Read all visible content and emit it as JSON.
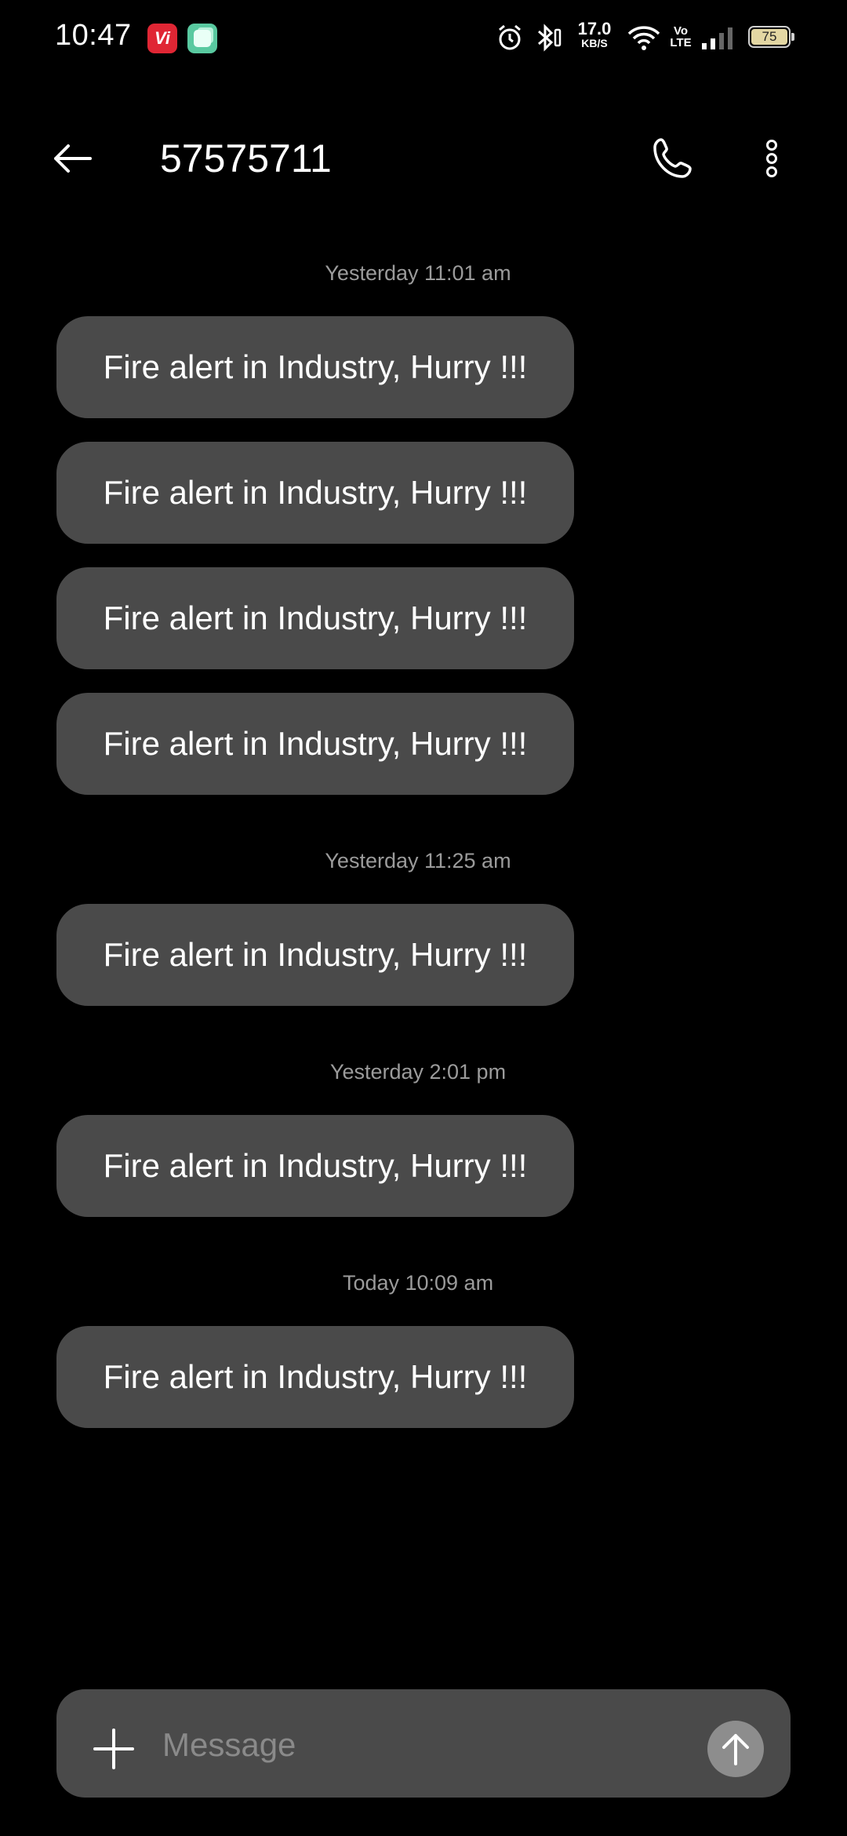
{
  "status_bar": {
    "time": "10:47",
    "app_badge_vi": "Vi",
    "net_speed_value": "17.0",
    "net_speed_unit": "KB/S",
    "volte_top": "Vo",
    "volte_bottom": "LTE",
    "battery": "75",
    "icons": [
      "alarm-icon",
      "bluetooth-icon",
      "wifi-icon",
      "signal-icon"
    ]
  },
  "header": {
    "title": "57575711",
    "icons": [
      "back-arrow-icon",
      "phone-icon",
      "more-vert-icon"
    ]
  },
  "conversation": {
    "groups": [
      {
        "timestamp": "Yesterday 11:01 am",
        "messages": [
          "Fire alert in Industry, Hurry !!!",
          "Fire alert in Industry, Hurry !!!",
          "Fire alert in Industry, Hurry !!!",
          "Fire alert in Industry, Hurry !!!"
        ]
      },
      {
        "timestamp": "Yesterday 11:25 am",
        "messages": [
          "Fire alert in Industry, Hurry !!!"
        ]
      },
      {
        "timestamp": "Yesterday 2:01 pm",
        "messages": [
          "Fire alert in Industry, Hurry !!!"
        ]
      },
      {
        "timestamp": "Today 10:09 am",
        "messages": [
          "Fire alert in Industry, Hurry !!!"
        ]
      }
    ]
  },
  "composer": {
    "placeholder": "Message",
    "value": "",
    "icons": [
      "plus-icon",
      "send-arrow-up-icon"
    ]
  },
  "colors": {
    "background": "#000000",
    "bubble": "#4a4a4a",
    "timestamp": "#9b9b9b",
    "send_button": "#8d8d8d"
  }
}
